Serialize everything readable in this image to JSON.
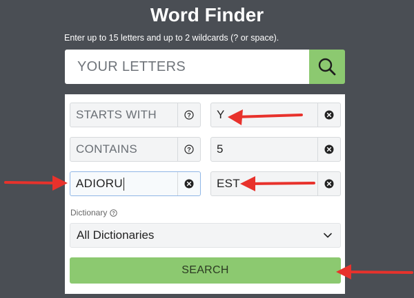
{
  "header": {
    "title": "Word Finder",
    "subtitle": "Enter up to 15 letters and up to 2 wildcards (? or space)."
  },
  "letters_input": {
    "placeholder": "YOUR LETTERS"
  },
  "filters": {
    "starts_with": {
      "placeholder": "STARTS WITH",
      "value": "Y"
    },
    "contains": {
      "placeholder": "CONTAINS",
      "value": "5"
    },
    "unlabeled_left": {
      "value": "ADIORU"
    },
    "ends_with": {
      "value": "EST"
    }
  },
  "dictionary": {
    "label": "Dictionary",
    "selected": "All Dictionaries"
  },
  "search_button": {
    "label": "SEARCH"
  },
  "icons": {
    "search": "search-icon",
    "help": "question-circle-icon",
    "clear": "clear-x-icon",
    "dropdown": "chevron-down-icon",
    "annotation": "red-arrow"
  },
  "colors": {
    "background": "#4a4e54",
    "accent_green": "#8cc970",
    "annotation_red": "#e8322c"
  }
}
